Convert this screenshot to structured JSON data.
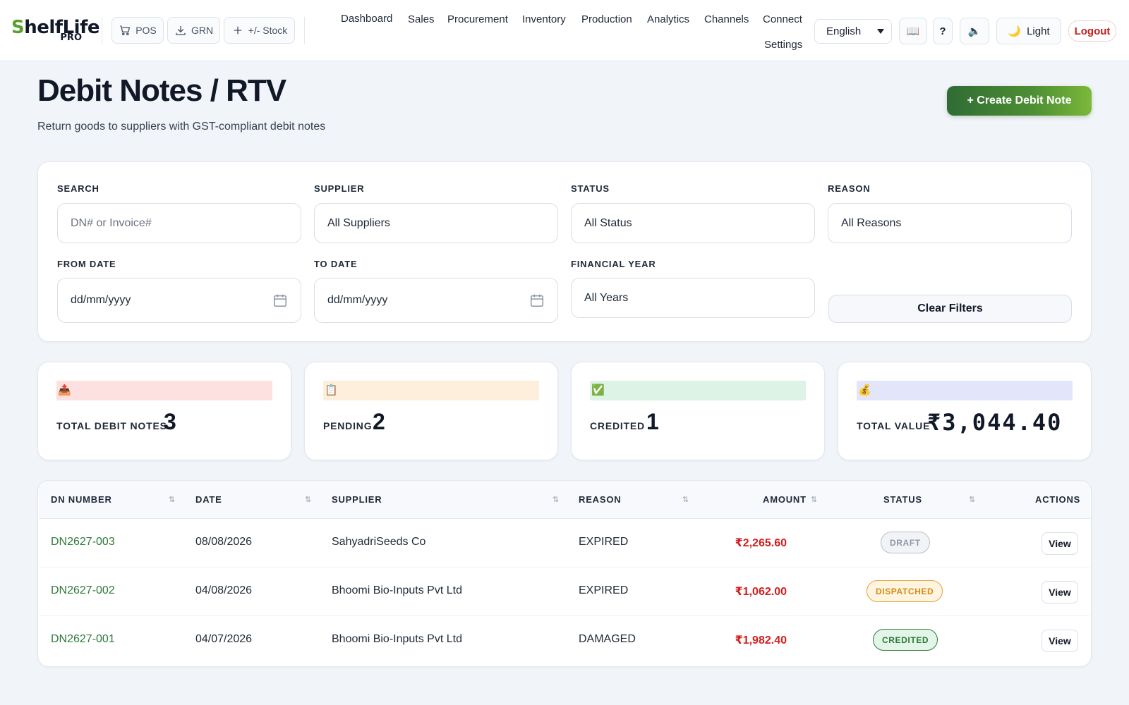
{
  "brand": {
    "logo_main": "helfLife",
    "logo_s": "S",
    "logo_sub": "PRO"
  },
  "quick_actions": [
    {
      "label": "POS",
      "icon": "cart-icon"
    },
    {
      "label": "GRN",
      "icon": "download-icon"
    },
    {
      "label": "+/- Stock",
      "icon": "plus-icon"
    }
  ],
  "nav": [
    "Dashboard",
    "Sales",
    "Procurement",
    "Inventory",
    "Production",
    "Analytics",
    "Channels",
    "Connect",
    "Settings"
  ],
  "language": {
    "selected": "English"
  },
  "toolbar": {
    "guide_icon": "📖",
    "help_label": "?",
    "sound_icon": "🔈",
    "theme_icon": "🌙",
    "theme_label": "Light",
    "logout_label": "Logout"
  },
  "header": {
    "title": "Debit Notes / RTV",
    "subtitle": "Return goods to suppliers with GST-compliant debit notes",
    "create_button": "+ Create Debit Note"
  },
  "filters": {
    "search": {
      "label": "SEARCH",
      "placeholder": "DN# or Invoice#"
    },
    "supplier": {
      "label": "SUPPLIER",
      "value": "All Suppliers"
    },
    "status": {
      "label": "STATUS",
      "value": "All Status"
    },
    "reason": {
      "label": "REASON",
      "value": "All Reasons"
    },
    "from_date": {
      "label": "FROM DATE",
      "placeholder": "dd/mm/yyyy"
    },
    "to_date": {
      "label": "TO DATE",
      "placeholder": "dd/mm/yyyy"
    },
    "financial_year": {
      "label": "FINANCIAL YEAR",
      "value": "All Years"
    },
    "clear_button": "Clear Filters"
  },
  "stats": [
    {
      "icon": "📤",
      "label": "TOTAL DEBIT NOTES",
      "value": "3",
      "color": "#fde0e0"
    },
    {
      "icon": "📋",
      "label": "PENDING",
      "value": "2",
      "color": "#fdefdc"
    },
    {
      "icon": "✅",
      "label": "CREDITED",
      "value": "1",
      "color": "#dcf3e6"
    },
    {
      "icon": "💰",
      "label": "TOTAL VALUE",
      "value": "₹3,044.40",
      "color": "#e3e6fb"
    }
  ],
  "table": {
    "columns": [
      "DN NUMBER",
      "DATE",
      "SUPPLIER",
      "REASON",
      "AMOUNT",
      "STATUS",
      "ACTIONS"
    ],
    "rows": [
      {
        "dn": "DN2627-003",
        "date": "08/08/2026",
        "supplier": "SahyadriSeeds Co",
        "reason": "EXPIRED",
        "amount": "₹2,265.60",
        "status": "DRAFT",
        "action": "View"
      },
      {
        "dn": "DN2627-002",
        "date": "04/08/2026",
        "supplier": "Bhoomi Bio-Inputs Pvt Ltd",
        "reason": "EXPIRED",
        "amount": "₹1,062.00",
        "status": "DISPATCHED",
        "action": "View"
      },
      {
        "dn": "DN2627-001",
        "date": "04/07/2026",
        "supplier": "Bhoomi Bio-Inputs Pvt Ltd",
        "reason": "DAMAGED",
        "amount": "₹1,982.40",
        "status": "CREDITED",
        "action": "View"
      }
    ]
  },
  "colors": {
    "accent_green": "#2f7a3b",
    "amount_red": "#d21f1f",
    "logout_red": "#c81e1e",
    "badge_draft": "#9aa3b2",
    "badge_dispatched": "#d98a12",
    "badge_credited": "#2f7a3b"
  }
}
